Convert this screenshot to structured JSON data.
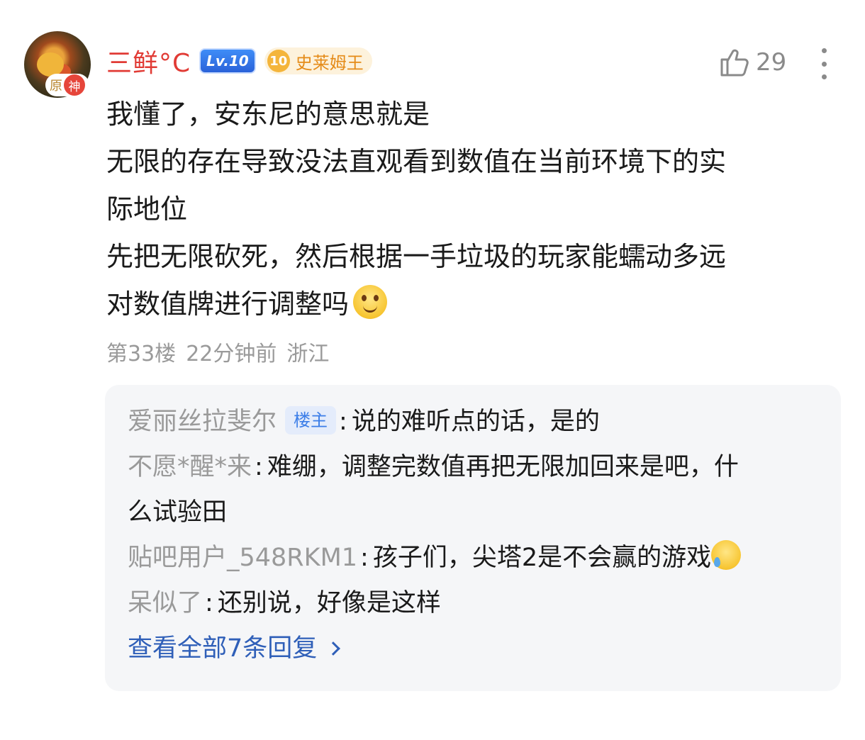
{
  "comment": {
    "user": {
      "name": "三鲜°C",
      "level_badge": "Lv.10",
      "title_level": "10",
      "title_name": "史莱姆王",
      "avatar_tag_left": "原",
      "avatar_tag_right": "神"
    },
    "like_count": "29",
    "lines": [
      "我懂了，安东尼的意思就是",
      "无限的存在导致没法直观看到数值在当前环境下的实",
      "际地位",
      "先把无限砍死，然后根据一手垃圾的玩家能蠕动多远",
      "对数值牌进行调整吗"
    ],
    "meta": {
      "floor": "第33楼",
      "time": "22分钟前",
      "location": "浙江"
    }
  },
  "replies": {
    "items": [
      {
        "name": "爱丽丝拉斐尔",
        "tag": "楼主",
        "text": "说的难听点的话，是的"
      },
      {
        "name": "不愿*醒*来",
        "text": "难绷，调整完数值再把无限加回来是吧，什",
        "text2": "么试验田"
      },
      {
        "name": "贴吧用户_548RKM1",
        "text": "孩子们，尖塔2是不会赢的游戏"
      },
      {
        "name": "呆似了",
        "text": "还别说，好像是这样"
      }
    ],
    "view_all": "查看全部7条回复"
  },
  "colors": {
    "username": "#e13b35",
    "link": "#2f5fb8",
    "muted": "#9a9a9a",
    "reply_bg": "#f5f6f8"
  },
  "icons": [
    "thumbs-up-icon",
    "more-vertical-icon",
    "smile-emoji-icon",
    "sweat-smile-emoji-icon",
    "chevron-right-icon"
  ]
}
